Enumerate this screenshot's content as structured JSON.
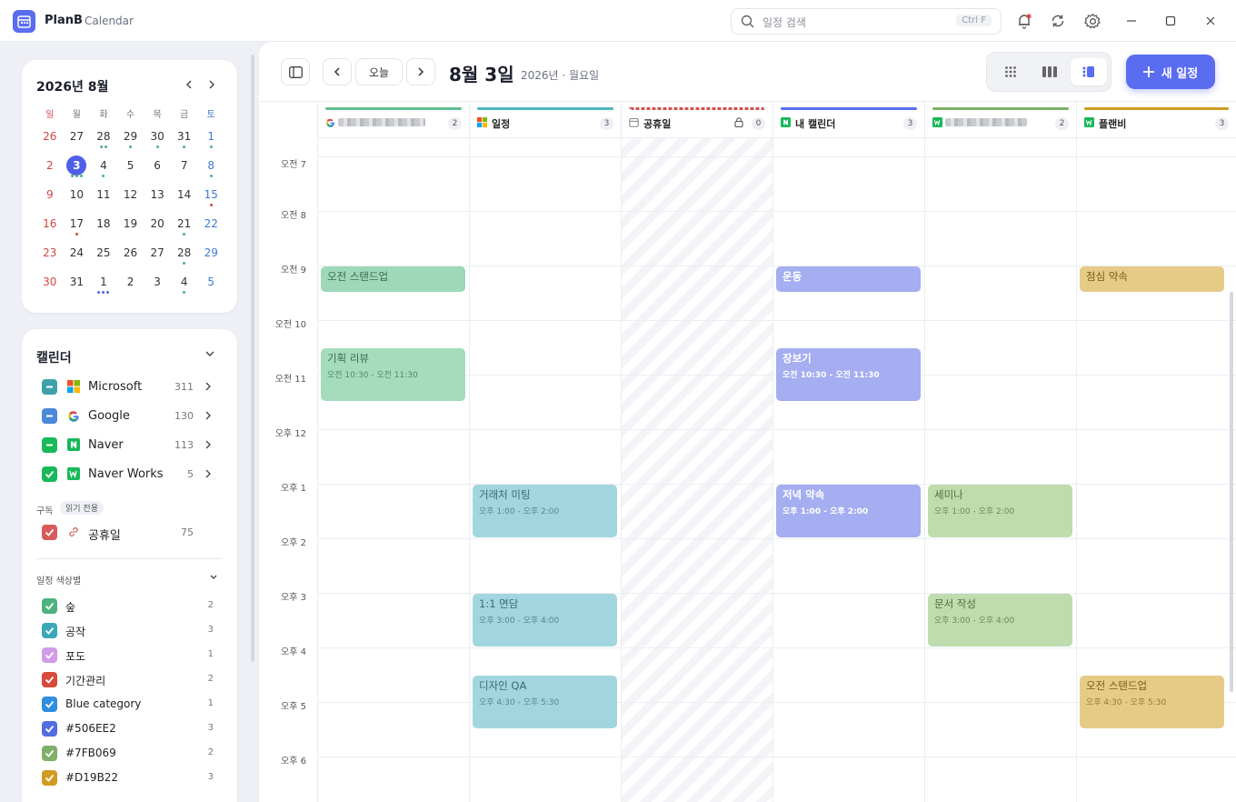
{
  "window": {
    "app_name": "PlanB",
    "app_subtitle": "Calendar",
    "search_placeholder": "일정 검색",
    "search_shortcut": "Ctrl F"
  },
  "mini_calendar": {
    "title": "2026년 8월",
    "weekdays": [
      "일",
      "월",
      "화",
      "수",
      "목",
      "금",
      "토"
    ],
    "weeks": [
      [
        {
          "d": "26",
          "dots": []
        },
        {
          "d": "27",
          "dots": []
        },
        {
          "d": "28",
          "dots": [
            "#4db37e",
            "#4db37e"
          ]
        },
        {
          "d": "29",
          "dots": [
            "#4db37e"
          ]
        },
        {
          "d": "30",
          "dots": [
            "#4db37e"
          ]
        },
        {
          "d": "31",
          "dots": [
            "#4db37e"
          ]
        },
        {
          "d": "1",
          "dots": [
            "#4db37e"
          ]
        }
      ],
      [
        {
          "d": "2",
          "dots": []
        },
        {
          "d": "3",
          "dots": [
            "#4db37e",
            "#4db37e",
            "#4db37e"
          ],
          "today": true
        },
        {
          "d": "4",
          "dots": [
            "#4db37e"
          ]
        },
        {
          "d": "5",
          "dots": []
        },
        {
          "d": "6",
          "dots": []
        },
        {
          "d": "7",
          "dots": []
        },
        {
          "d": "8",
          "dots": [
            "#4db37e"
          ]
        }
      ],
      [
        {
          "d": "9",
          "dots": []
        },
        {
          "d": "10",
          "dots": []
        },
        {
          "d": "11",
          "dots": []
        },
        {
          "d": "12",
          "dots": []
        },
        {
          "d": "13",
          "dots": []
        },
        {
          "d": "14",
          "dots": []
        },
        {
          "d": "15",
          "dots": [
            "#d04545"
          ]
        }
      ],
      [
        {
          "d": "16",
          "dots": []
        },
        {
          "d": "17",
          "dots": [
            "#d04545"
          ]
        },
        {
          "d": "18",
          "dots": []
        },
        {
          "d": "19",
          "dots": []
        },
        {
          "d": "20",
          "dots": []
        },
        {
          "d": "21",
          "dots": [
            "#4db37e"
          ]
        },
        {
          "d": "22",
          "dots": []
        }
      ],
      [
        {
          "d": "23",
          "dots": []
        },
        {
          "d": "24",
          "dots": []
        },
        {
          "d": "25",
          "dots": []
        },
        {
          "d": "26",
          "dots": []
        },
        {
          "d": "27",
          "dots": []
        },
        {
          "d": "28",
          "dots": [
            "#4db37e"
          ]
        },
        {
          "d": "29",
          "dots": []
        }
      ],
      [
        {
          "d": "30",
          "dots": []
        },
        {
          "d": "31",
          "dots": []
        },
        {
          "d": "1",
          "dots": [
            "#4f6ad8",
            "#4f6ad8",
            "#4f6ad8"
          ]
        },
        {
          "d": "2",
          "dots": []
        },
        {
          "d": "3",
          "dots": []
        },
        {
          "d": "4",
          "dots": [
            "#4db37e"
          ]
        },
        {
          "d": "5",
          "dots": []
        }
      ]
    ]
  },
  "calendars": {
    "title": "캘린더",
    "accounts": [
      {
        "name": "Microsoft",
        "count": "311",
        "color": "#3fa0a8",
        "brand": "microsoft-logo",
        "check": "minus"
      },
      {
        "name": "Google",
        "count": "130",
        "color": "#4a8ad8",
        "brand": "google-logo",
        "check": "minus"
      },
      {
        "name": "Naver",
        "count": "113",
        "color": "#19b85a",
        "brand": "naver-logo",
        "check": "minus"
      },
      {
        "name": "Naver Works",
        "count": "5",
        "color": "#19b85a",
        "brand": "naver-works-logo",
        "check": "check"
      }
    ],
    "subscription_label": "구독",
    "read_only_badge": "읽기 전용",
    "subscription": {
      "name": "공휴일",
      "count": "75",
      "color": "#d85a5a"
    },
    "color_section_title": "일정 색상별",
    "colors": [
      {
        "name": "숲",
        "count": "2",
        "color": "#4db37e"
      },
      {
        "name": "공작",
        "count": "3",
        "color": "#3aa8b8"
      },
      {
        "name": "포도",
        "count": "1",
        "color": "#d29be8"
      },
      {
        "name": "기간관리",
        "count": "2",
        "color": "#d84a3a"
      },
      {
        "name": "Blue category",
        "count": "1",
        "color": "#2f8ee0"
      },
      {
        "name": "#506EE2",
        "count": "3",
        "color": "#506EE2"
      },
      {
        "name": "#7FB069",
        "count": "2",
        "color": "#7FB069"
      },
      {
        "name": "#D19B22",
        "count": "3",
        "color": "#D19B22"
      }
    ]
  },
  "toolbar": {
    "today_label": "오늘",
    "date_title": "8월 3일",
    "date_sub": "2026년 · 월요일",
    "new_event_label": "새 일정"
  },
  "columns": [
    {
      "name": "",
      "blurred": true,
      "count": "2",
      "bar": "#5cbf8a",
      "icon": "google-logo"
    },
    {
      "name": "일정",
      "count": "3",
      "bar": "#4fb5bd",
      "icon": "microsoft-logo"
    },
    {
      "name": "공휴일",
      "count": "0",
      "bar": "#d05050",
      "icon": "calendar-icon",
      "holiday": true
    },
    {
      "name": "내 캘린더",
      "count": "3",
      "bar": "#5a6cf0",
      "icon": "naver-logo"
    },
    {
      "name": "",
      "blurred": true,
      "count": "2",
      "bar": "#7fb069",
      "icon": "naver-works-logo"
    },
    {
      "name": "플랜비",
      "count": "3",
      "bar": "#d19b22",
      "icon": "naver-works-logo"
    }
  ],
  "hours": [
    "오전 7",
    "오전 8",
    "오전 9",
    "오전 10",
    "오전 11",
    "오후 12",
    "오후 1",
    "오후 2",
    "오후 3",
    "오후 4",
    "오후 5",
    "오후 6"
  ],
  "events": [
    {
      "col": 0,
      "start": 9.0,
      "end": 9.5,
      "title": "오전 스탠드업",
      "time": "",
      "bg": "#9fd8b8",
      "fg": "#3d6b52"
    },
    {
      "col": 0,
      "start": 10.5,
      "end": 11.5,
      "title": "기획 리뷰",
      "time": "오전 10:30 - 오전 11:30",
      "bg": "#a5dcbc",
      "fg": "#3d6b52"
    },
    {
      "col": 1,
      "start": 13.0,
      "end": 14.0,
      "title": "거래처 미팅",
      "time": "오후 1:00 - 오후 2:00",
      "bg": "#a2d6de",
      "fg": "#3c6a72"
    },
    {
      "col": 1,
      "start": 15.0,
      "end": 16.0,
      "title": "1:1 면담",
      "time": "오후 3:00 - 오후 4:00",
      "bg": "#a2d6de",
      "fg": "#3c6a72"
    },
    {
      "col": 1,
      "start": 16.5,
      "end": 17.5,
      "title": "디자인 QA",
      "time": "오후 4:30 - 오후 5:30",
      "bg": "#a2d6de",
      "fg": "#3c6a72"
    },
    {
      "col": 3,
      "start": 9.0,
      "end": 9.5,
      "title": "운동",
      "time": "",
      "bg": "#a4aef0",
      "fg": "#ffffff"
    },
    {
      "col": 3,
      "start": 10.5,
      "end": 11.5,
      "title": "장보기",
      "time": "오전 10:30 - 오전 11:30",
      "bg": "#a4aef0",
      "fg": "#ffffff"
    },
    {
      "col": 3,
      "start": 13.0,
      "end": 14.0,
      "title": "저녁 약속",
      "time": "오후 1:00 - 오후 2:00",
      "bg": "#a4aef0",
      "fg": "#ffffff"
    },
    {
      "col": 4,
      "start": 13.0,
      "end": 14.0,
      "title": "세미나",
      "time": "오후 1:00 - 오후 2:00",
      "bg": "#bfdcae",
      "fg": "#4f6e40"
    },
    {
      "col": 4,
      "start": 15.0,
      "end": 16.0,
      "title": "문서 작성",
      "time": "오후 3:00 - 오후 4:00",
      "bg": "#bfdcae",
      "fg": "#4f6e40"
    },
    {
      "col": 5,
      "start": 9.0,
      "end": 9.5,
      "title": "점심 약속",
      "time": "",
      "bg": "#e6cb86",
      "fg": "#7a5d18"
    },
    {
      "col": 5,
      "start": 16.5,
      "end": 17.5,
      "title": "오전 스탠드업",
      "time": "오후 4:30 - 오후 5:30",
      "bg": "#e6cb86",
      "fg": "#7a5d18"
    }
  ]
}
